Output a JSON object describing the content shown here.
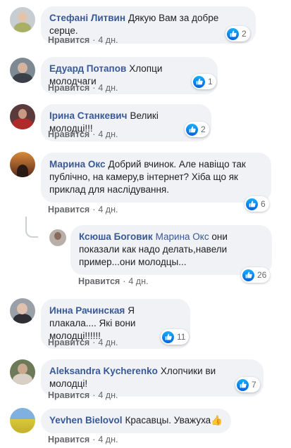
{
  "like_label": "Нравится",
  "separator": "·",
  "comments": [
    {
      "author": "Стефані Литвин",
      "text": "Дякую Вам за добре серце.",
      "time": "4 дн.",
      "reactions": "2"
    },
    {
      "author": "Едуард Потапов",
      "text": "Хлопци молодчаги",
      "time": "4 дн.",
      "reactions": "1"
    },
    {
      "author": "Ірина Станкевич",
      "text": "Великі молодці!!!",
      "time": "4 дн.",
      "reactions": "2"
    },
    {
      "author": "Марина Окс",
      "text": "Добрий вчинок. Але навіщо так публічно, на камеру,в інтернет? Хіба що як приклад для наслідування.",
      "time": "4 дн.",
      "reactions": "6"
    },
    {
      "author": "Ксюша Боговик",
      "mention": "Марина Окс",
      "text": "они показали как надо делать,навели пример...они молодцы...",
      "time": "4 дн.",
      "reactions": "26"
    },
    {
      "author": "Инна Рачинская",
      "text": "Я плакала.... Які вони молодці!!!!!!",
      "time": "4 дн.",
      "reactions": "11"
    },
    {
      "author": "Aleksandra Kycherenko",
      "text": "Хлопчики ви молодці!",
      "time": "4 дн.",
      "reactions": "7"
    },
    {
      "author": "Yevhen Bielovol",
      "text": "Красавцы. Уважуха👍",
      "time": "4 дн.",
      "reactions": ""
    }
  ]
}
